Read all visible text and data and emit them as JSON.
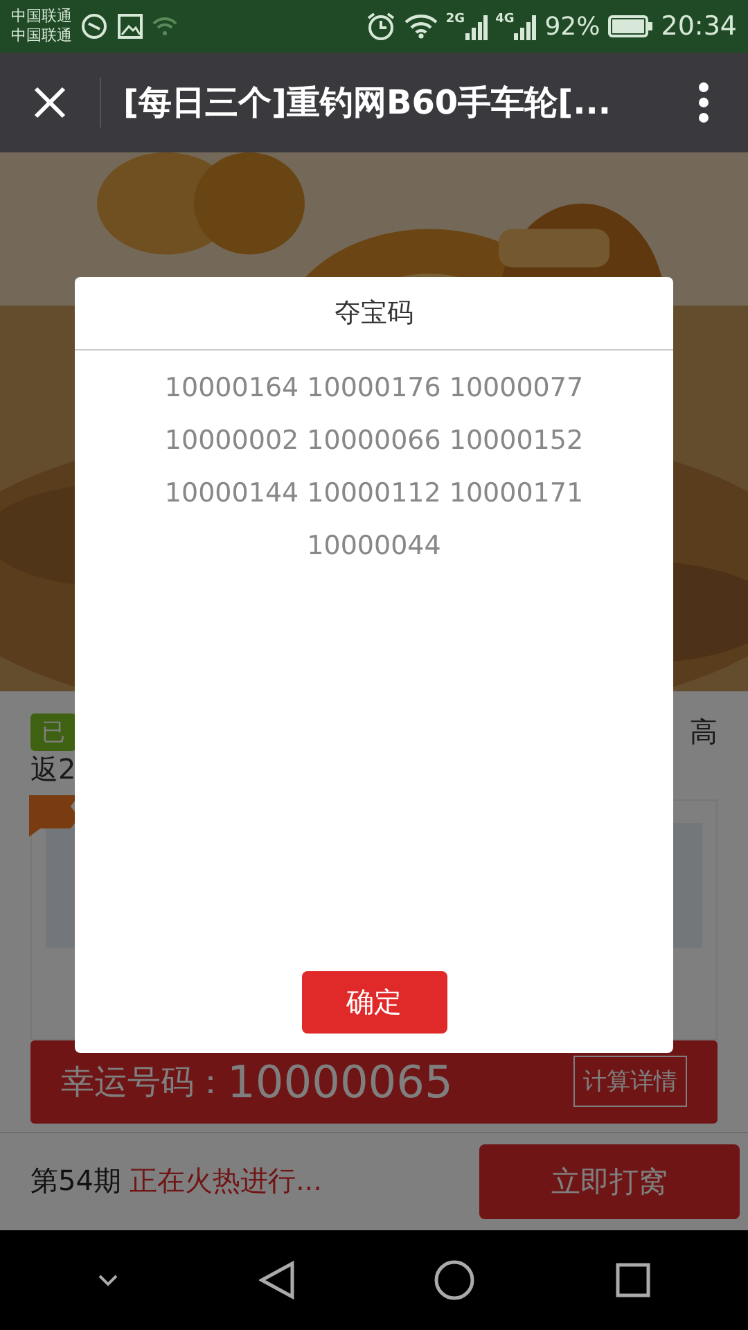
{
  "status_bar": {
    "carriers": [
      "中国联通",
      "中国联通"
    ],
    "signal_labels": [
      "2G",
      "4G"
    ],
    "battery": "92%",
    "time": "20:34"
  },
  "nav_bar": {
    "title": "[每日三个]重钓网B60手车轮[..."
  },
  "page": {
    "badge": "已",
    "desc_left": "返2",
    "desc_right": "高",
    "lucky": {
      "label": "幸运号码：",
      "number": "10000065",
      "detail_button": "计算详情"
    },
    "footer": {
      "period": "第54期",
      "status": "正在火热进行...",
      "action": "立即打窝"
    }
  },
  "dialog": {
    "title": "夺宝码",
    "codes": [
      "10000164",
      "10000176",
      "10000077",
      "10000002",
      "10000066",
      "10000152",
      "10000144",
      "10000112",
      "10000171",
      "10000044"
    ],
    "confirm": "确定"
  }
}
